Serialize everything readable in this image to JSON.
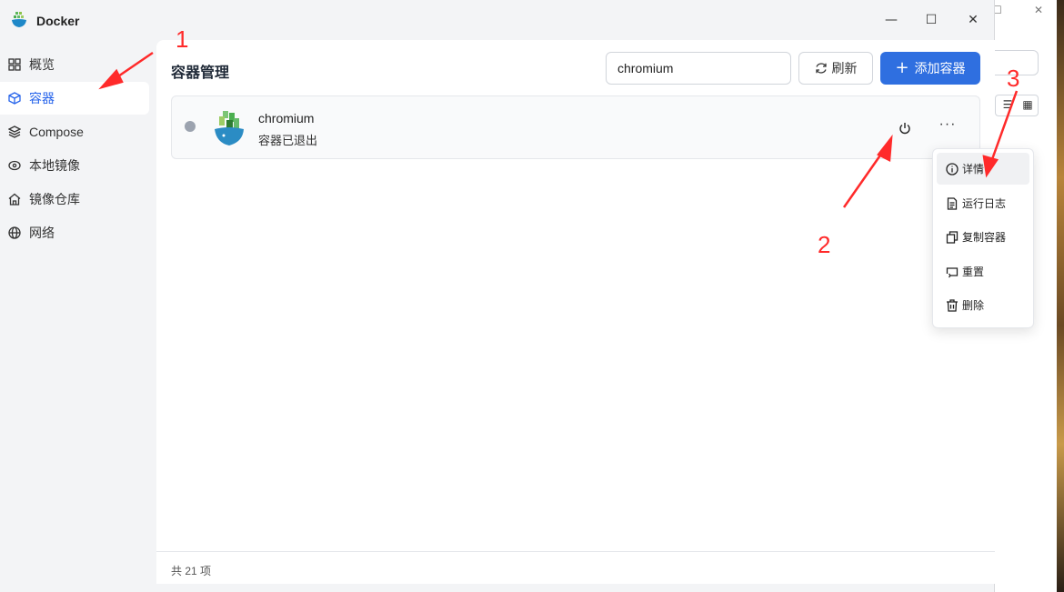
{
  "app": {
    "title": "Docker"
  },
  "sidebar": {
    "items": [
      {
        "label": "概览",
        "icon": "grid-icon",
        "active": false
      },
      {
        "label": "容器",
        "icon": "cube-icon",
        "active": true
      },
      {
        "label": "Compose",
        "icon": "layers-icon",
        "active": false
      },
      {
        "label": "本地镜像",
        "icon": "disk-icon",
        "active": false
      },
      {
        "label": "镜像仓库",
        "icon": "home-icon",
        "active": false
      },
      {
        "label": "网络",
        "icon": "globe-icon",
        "active": false
      }
    ]
  },
  "main": {
    "title": "容器管理",
    "search": {
      "value": "chromium"
    },
    "refresh_label": "刷新",
    "add_label": "添加容器",
    "containers": [
      {
        "name": "chromium",
        "status": "容器已退出"
      }
    ],
    "footer": "共 21 项"
  },
  "menu": {
    "items": [
      {
        "label": "详情",
        "icon": "info-icon"
      },
      {
        "label": "运行日志",
        "icon": "log-icon"
      },
      {
        "label": "复制容器",
        "icon": "copy-icon"
      },
      {
        "label": "重置",
        "icon": "reset-icon"
      },
      {
        "label": "删除",
        "icon": "trash-icon"
      }
    ]
  },
  "annotations": {
    "n1": "1",
    "n2": "2",
    "n3": "3"
  },
  "colors": {
    "accent": "#2f6fe0",
    "annotation": "#ff2a2a",
    "status_stopped": "#9ca3af"
  }
}
